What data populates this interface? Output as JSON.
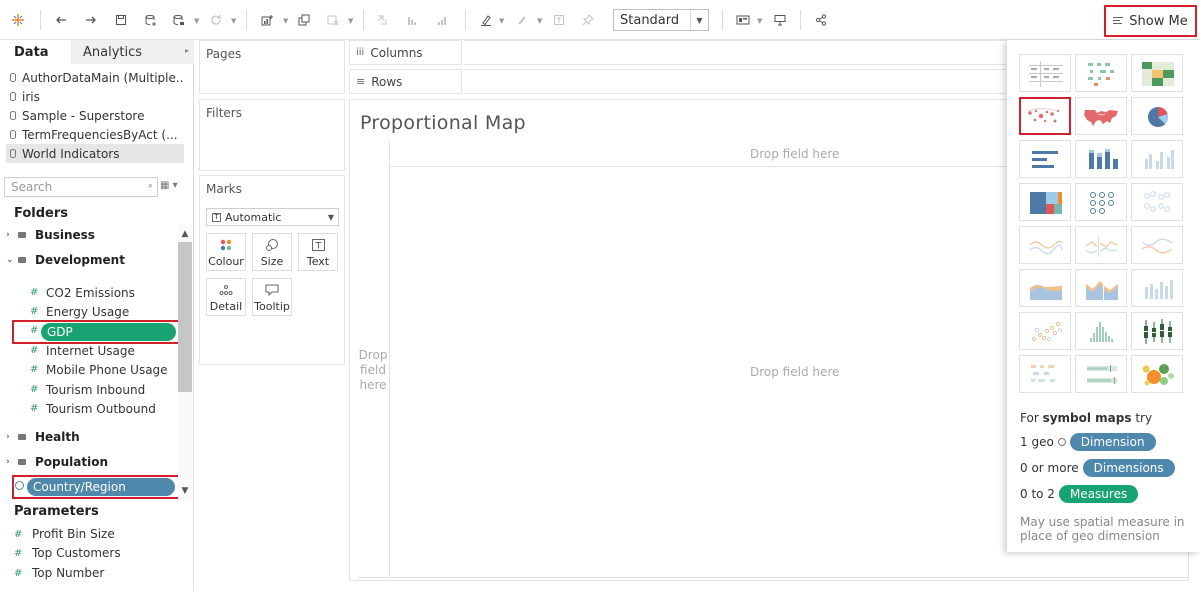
{
  "toolbar": {
    "view_size_select": "Standard",
    "show_me_label": "Show Me"
  },
  "data_pane": {
    "tabs": {
      "data": "Data",
      "analytics": "Analytics"
    },
    "data_sources": [
      "AuthorDataMain (Multiple...",
      "iris",
      "Sample - Superstore",
      "TermFrequenciesByAct (...",
      "World Indicators"
    ],
    "search_placeholder": "Search",
    "folders_heading": "Folders",
    "folders": {
      "business": "Business",
      "development": "Development",
      "health": "Health",
      "population": "Population"
    },
    "development_fields": [
      "CO2 Emissions",
      "Energy Usage",
      "GDP",
      "Internet Usage",
      "Mobile Phone Usage",
      "Tourism Inbound",
      "Tourism Outbound"
    ],
    "geo_field": "Country/Region",
    "parameters_heading": "Parameters",
    "parameters": [
      "Profit Bin Size",
      "Top Customers",
      "Top Number"
    ]
  },
  "cards": {
    "pages": "Pages",
    "filters": "Filters",
    "marks": "Marks",
    "mark_type": "Automatic",
    "mark_buttons": {
      "colour": "Colour",
      "size": "Size",
      "text": "Text",
      "detail": "Detail",
      "tooltip": "Tooltip"
    }
  },
  "shelves": {
    "columns": "Columns",
    "rows": "Rows"
  },
  "view": {
    "title": "Proportional Map",
    "drop_field_top": "Drop field here",
    "drop_field_center": "Drop field here",
    "drop_field_rows_1": "Drop",
    "drop_field_rows_2": "field",
    "drop_field_rows_3": "here"
  },
  "show_me": {
    "hint_prefix": "For ",
    "hint_bold": "symbol maps",
    "hint_suffix": " try",
    "req1_prefix": "1 geo",
    "req1_pill": "Dimension",
    "req2_prefix": "0 or more",
    "req2_pill": "Dimensions",
    "req3_prefix": "0 to 2",
    "req3_pill": "Measures",
    "note": "May use spatial measure in place of geo dimension",
    "colors": {
      "dimension": "#4e88ad",
      "measure": "#18a472",
      "highlight": "#d4202a"
    }
  }
}
